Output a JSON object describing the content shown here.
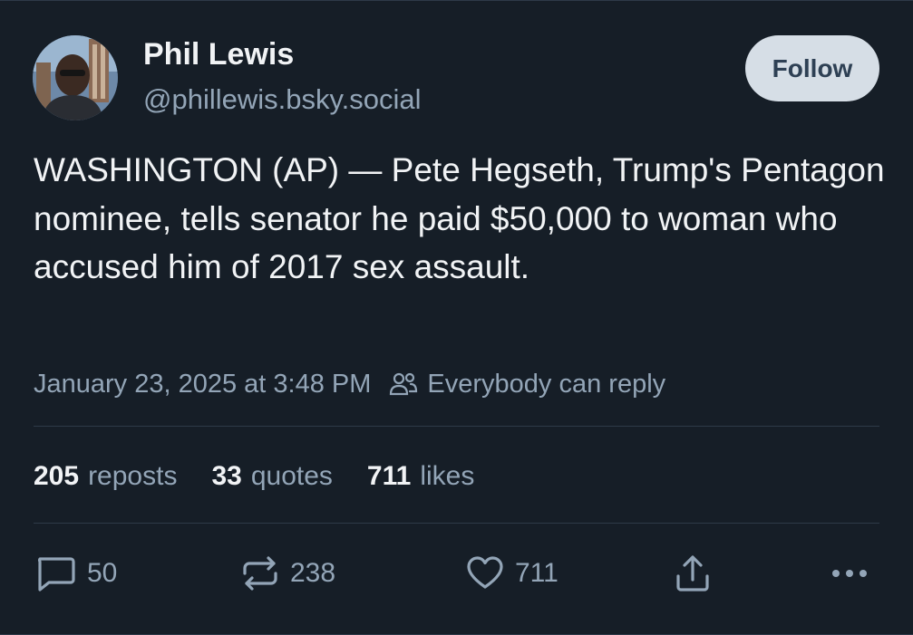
{
  "author": {
    "display_name": "Phil Lewis",
    "handle": "@phillewis.bsky.social",
    "avatar_icon": "user-photo-avatar"
  },
  "follow_label": "Follow",
  "post": {
    "text": "WASHINGTON (AP) — Pete Hegseth, Trump's Pentagon nominee, tells senator he paid $50,000 to woman who accused him of 2017 sex assault.",
    "timestamp": "January 23, 2025 at 3:48 PM",
    "reply_setting": "Everybody can reply"
  },
  "stats": {
    "reposts": {
      "count": "205",
      "label": "reposts"
    },
    "quotes": {
      "count": "33",
      "label": "quotes"
    },
    "likes": {
      "count": "711",
      "label": "likes"
    }
  },
  "actions": {
    "reply": {
      "icon": "reply-bubble-icon",
      "count": "50"
    },
    "repost": {
      "icon": "repost-icon",
      "count": "238"
    },
    "like": {
      "icon": "heart-icon",
      "count": "711"
    },
    "share": {
      "icon": "share-icon"
    },
    "more": {
      "icon": "more-options-icon"
    }
  },
  "colors": {
    "background": "#161e27",
    "primary_text": "#f1f3f5",
    "secondary_text": "#93a5b7",
    "follow_button_bg": "#d6dee6",
    "follow_button_text": "#2e4054",
    "divider": "#2e3a48"
  }
}
